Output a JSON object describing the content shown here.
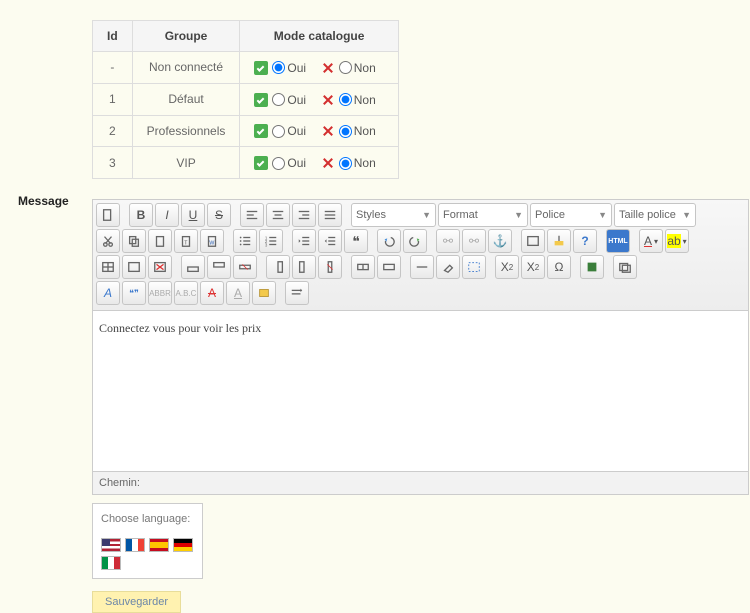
{
  "table": {
    "headers": {
      "id": "Id",
      "group": "Groupe",
      "mode": "Mode catalogue"
    },
    "yes": "Oui",
    "no": "Non",
    "rows": [
      {
        "id": "-",
        "group": "Non connecté",
        "selected": "yes"
      },
      {
        "id": "1",
        "group": "Défaut",
        "selected": "no"
      },
      {
        "id": "2",
        "group": "Professionnels",
        "selected": "no"
      },
      {
        "id": "3",
        "group": "VIP",
        "selected": "no"
      }
    ]
  },
  "labels": {
    "message": "Message",
    "chemin": "Chemin:",
    "choose_lang": "Choose language:",
    "save": "Sauvegarder"
  },
  "editor": {
    "content": "Connectez vous pour voir les prix",
    "selects": {
      "styles": "Styles",
      "format": "Format",
      "police": "Police",
      "taille": "Taille police"
    }
  }
}
